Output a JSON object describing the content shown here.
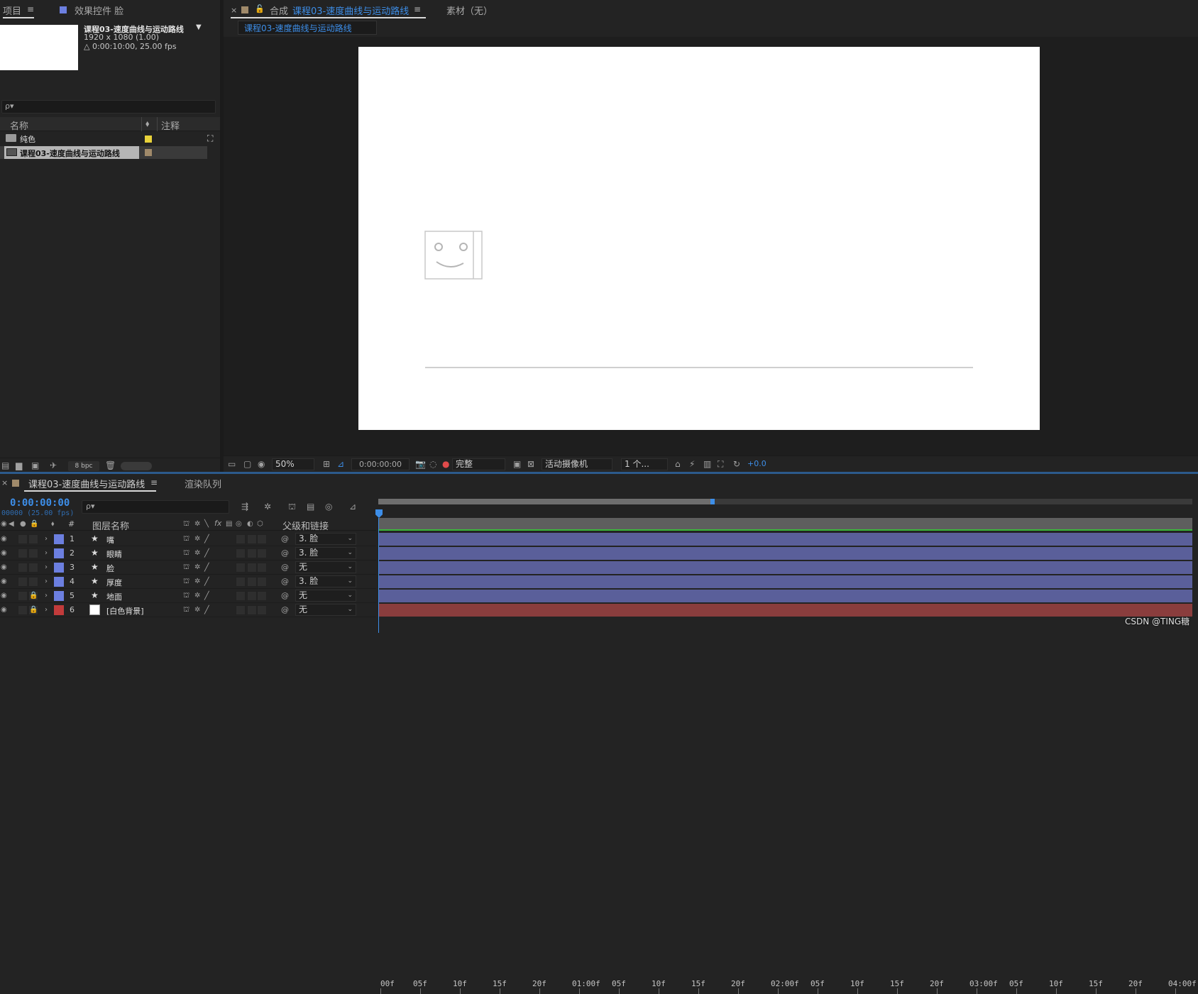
{
  "project_panel": {
    "tab_project": "项目",
    "tab_effects": "效果控件 脸",
    "comp_name": "课程03-速度曲线与运动路线",
    "comp_size": "1920 x 1080 (1.00)",
    "comp_duration": "△ 0:00:10:00, 25.00 fps",
    "search_placeholder": "ρ▾",
    "col_name": "名称",
    "col_comment": "注释",
    "items": [
      {
        "name": "纯色",
        "color": "#e8d23a",
        "type": "folder"
      },
      {
        "name": "课程03-速度曲线与运动路线",
        "color": "#a08a6a",
        "type": "comp"
      }
    ],
    "bpc": "8 bpc"
  },
  "viewer": {
    "tab_comp_prefix": "合成",
    "tab_comp_name": "课程03-速度曲线与运动路线",
    "tab_footage": "素材（无）",
    "breadcrumb": "课程03-速度曲线与运动路线",
    "zoom": "50%",
    "timecode": "0:00:00:00",
    "resolution": "完整",
    "camera": "活动摄像机",
    "views": "1 个...",
    "exposure": "+0.0"
  },
  "timeline": {
    "tab_comp": "课程03-速度曲线与运动路线",
    "tab_render": "渲染队列",
    "timecode": "0:00:00:00",
    "fps_label": "00000 (25.00 fps)",
    "search_placeholder": "ρ▾",
    "col_num": "#",
    "col_layer_name": "图层名称",
    "col_parent": "父级和链接",
    "layers": [
      {
        "num": "1",
        "name": "嘴",
        "color": "#6c7fe0",
        "parent": "3. 脸",
        "locked": false,
        "type": "shape"
      },
      {
        "num": "2",
        "name": "眼睛",
        "color": "#6c7fe0",
        "parent": "3. 脸",
        "locked": false,
        "type": "shape"
      },
      {
        "num": "3",
        "name": "脸",
        "color": "#6c7fe0",
        "parent": "无",
        "locked": false,
        "type": "shape"
      },
      {
        "num": "4",
        "name": "厚度",
        "color": "#6c7fe0",
        "parent": "3. 脸",
        "locked": false,
        "type": "shape"
      },
      {
        "num": "5",
        "name": "地面",
        "color": "#6c7fe0",
        "parent": "无",
        "locked": true,
        "type": "shape"
      },
      {
        "num": "6",
        "name": "[白色背景]",
        "color": "#c23b3b",
        "parent": "无",
        "locked": true,
        "type": "solid"
      }
    ],
    "ruler": [
      "00f",
      "05f",
      "10f",
      "15f",
      "20f",
      "01:00f",
      "05f",
      "10f",
      "15f",
      "20f",
      "02:00f",
      "05f",
      "10f",
      "15f",
      "20f",
      "03:00f",
      "05f",
      "10f",
      "15f",
      "20f",
      "04:00f"
    ],
    "track_colors": {
      "shape": "#5a5f9a",
      "solid": "#8a3d3d"
    }
  },
  "watermark": "CSDN @TING糖"
}
